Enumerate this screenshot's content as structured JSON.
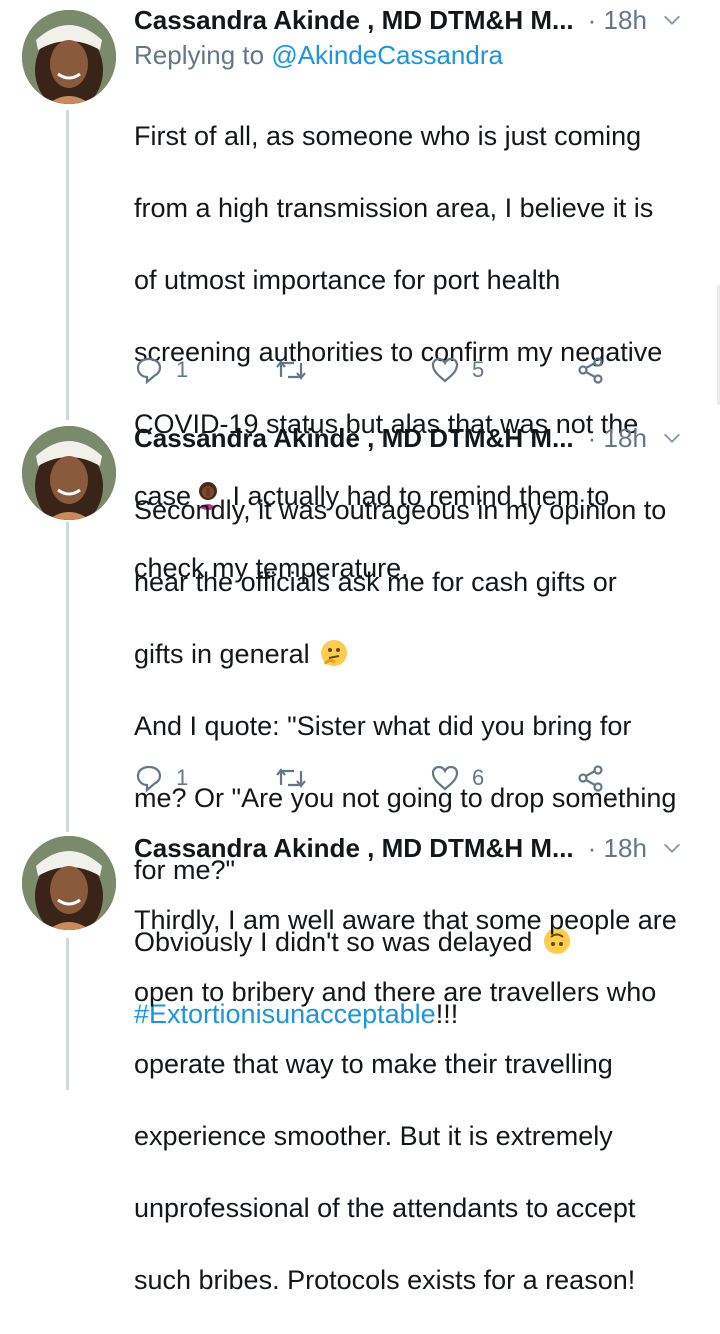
{
  "tweets": [
    {
      "author": "Cassandra Akinde , MD DTM&H M...",
      "time": "· 18h",
      "reply_prefix": "Replying to ",
      "reply_handle": "@AkindeCassandra",
      "lines": [
        "First of all,  as someone who is just coming",
        "from a high transmission area, I believe it is",
        "of utmost importance for port health",
        "screening authorities to confirm my negative",
        "COVID-19 status but alas that was not the",
        "case",
        " I actually had to remind them to",
        "check my temperature."
      ],
      "replies": "1",
      "likes": "5"
    },
    {
      "author": "Cassandra Akinde , MD DTM&H M...",
      "time": "· 18h",
      "lines": [
        "Secondly, it was outrageous in my opinion to",
        "hear the officials ask me for cash gifts or",
        "gifts in general",
        "And I quote: \"Sister what did you bring for",
        "me? Or \"Are you not going to drop something",
        "for me?\"",
        "Obviously I didn't so was delayed",
        "#Extortionisunacceptable",
        "!!!"
      ],
      "replies": "1",
      "likes": "6"
    },
    {
      "author": "Cassandra Akinde , MD DTM&H M...",
      "time": "· 18h",
      "lines": [
        "Thirdly,  I am well aware that some people are",
        "open to bribery and there are travellers who",
        "operate that way to make their travelling",
        "experience smoother. But it is extremely",
        "unprofessional of the attendants to accept",
        "such bribes. Protocols exists for a reason!"
      ]
    }
  ],
  "icons": {
    "reply": "reply-icon",
    "retweet": "retweet-icon",
    "like": "heart-icon",
    "share": "share-icon",
    "chevron": "chevron-down-icon"
  },
  "colors": {
    "link": "#1b95e0",
    "muted": "#657786",
    "text": "#14171a"
  }
}
